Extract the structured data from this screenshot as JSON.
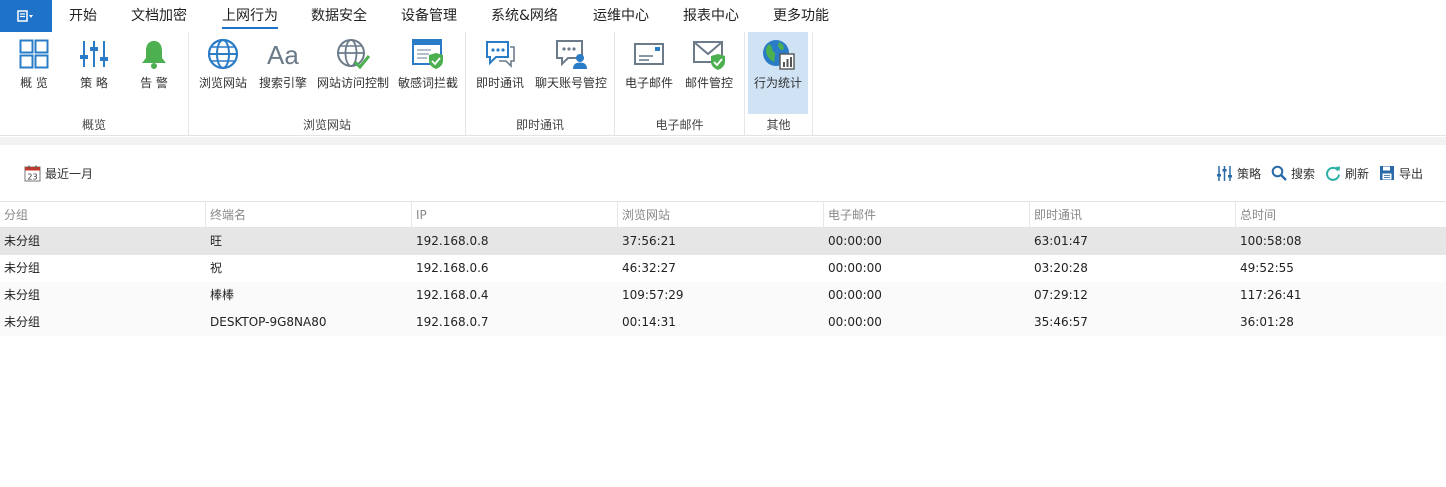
{
  "tabs": [
    {
      "label": "开始"
    },
    {
      "label": "文档加密"
    },
    {
      "label": "上网行为",
      "active": true
    },
    {
      "label": "数据安全"
    },
    {
      "label": "设备管理"
    },
    {
      "label": "系统&网络"
    },
    {
      "label": "运维中心"
    },
    {
      "label": "报表中心"
    },
    {
      "label": "更多功能"
    }
  ],
  "ribbon": {
    "groups": [
      {
        "label": "概览",
        "buttons": [
          {
            "label": "概  览",
            "icon": "grid-overview-icon"
          },
          {
            "label": "策  略",
            "icon": "sliders-icon"
          },
          {
            "label": "告  警",
            "icon": "bell-icon"
          }
        ]
      },
      {
        "label": "浏览网站",
        "buttons": [
          {
            "label": "浏览网站",
            "icon": "globe-icon"
          },
          {
            "label": "搜索引擎",
            "icon": "font-aa-icon"
          },
          {
            "label": "网站访问控制",
            "icon": "globe-check-icon"
          },
          {
            "label": "敏感词拦截",
            "icon": "window-shield-icon"
          }
        ]
      },
      {
        "label": "即时通讯",
        "buttons": [
          {
            "label": "即时通讯",
            "icon": "chat-bubble-icon"
          },
          {
            "label": "聊天账号管控",
            "icon": "chat-user-icon"
          }
        ]
      },
      {
        "label": "电子邮件",
        "buttons": [
          {
            "label": "电子邮件",
            "icon": "envelope-icon"
          },
          {
            "label": "邮件管控",
            "icon": "envelope-check-icon"
          }
        ]
      },
      {
        "label": "其他",
        "buttons": [
          {
            "label": "行为统计",
            "icon": "globe-stats-icon",
            "selected": true
          }
        ]
      }
    ]
  },
  "toolbar": {
    "date_range": "最近一月",
    "calendar_day": "23",
    "policy": "策略",
    "search": "搜索",
    "refresh": "刷新",
    "export": "导出"
  },
  "table": {
    "columns": [
      "分组",
      "终端名",
      "IP",
      "浏览网站",
      "电子邮件",
      "即时通讯",
      "总时间"
    ],
    "rows": [
      [
        "未分组",
        "旺",
        "192.168.0.8",
        "37:56:21",
        "00:00:00",
        "63:01:47",
        "100:58:08"
      ],
      [
        "未分组",
        "祝",
        "192.168.0.6",
        "46:32:27",
        "00:00:00",
        "03:20:28",
        "49:52:55"
      ],
      [
        "未分组",
        "棒棒",
        "192.168.0.4",
        "109:57:29",
        "00:00:00",
        "07:29:12",
        "117:26:41"
      ],
      [
        "未分组",
        "DESKTOP-9G8NA80",
        "192.168.0.7",
        "00:14:31",
        "00:00:00",
        "35:46:57",
        "36:01:28"
      ]
    ]
  },
  "colors": {
    "accent": "#1e73c9",
    "icon_blue": "#2a7cc7",
    "icon_green": "#4caf50",
    "selected_bg": "#cfe3f5"
  }
}
